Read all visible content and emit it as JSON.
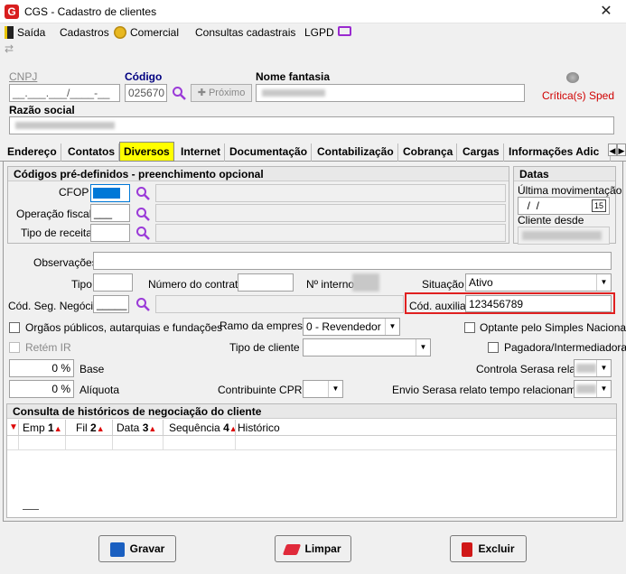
{
  "window": {
    "title": "CGS - Cadastro de clientes",
    "close": "✕"
  },
  "menu": {
    "items": [
      "Saída",
      "Cadastros",
      "Comercial",
      "Consultas cadastrais",
      "LGPD"
    ]
  },
  "header": {
    "cnpj_label": "CNPJ",
    "cnpj_value": "__.___.___/____-__",
    "codigo_label": "Código",
    "codigo_value": "025670",
    "proximo_label": "Próximo",
    "nome_fantasia_label": "Nome fantasia",
    "criticas_label": "Crítica(s) Sped",
    "razao_social_label": "Razão social"
  },
  "tabs": [
    "Endereço",
    "Contatos",
    "Diversos",
    "Internet",
    "Documentação",
    "Contabilização",
    "Cobrança",
    "Cargas",
    "Informações Adic"
  ],
  "active_tab": "Diversos",
  "codigos": {
    "title": "Códigos pré-definidos - preenchimento opcional",
    "cfop_label": "CFOP",
    "operacao_label": "Operação fiscal",
    "operacao_value": "___",
    "tipo_receita_label": "Tipo de receita"
  },
  "datas": {
    "title": "Datas",
    "ultima_label": "Última movimentação",
    "ultima_value": "  /  /",
    "cal": "15",
    "cliente_desde_label": "Cliente desde"
  },
  "form": {
    "observacoes_label": "Observações",
    "tipo_label": "Tipo",
    "numero_contrato_label": "Número do contrato",
    "n_interno_label": "Nº interno",
    "situacao_label": "Situação",
    "situacao_value": "Ativo",
    "cod_seg_label": "Cód. Seg. Negócio",
    "cod_seg_value": "_____",
    "cod_aux_label": "Cód. auxiliar",
    "cod_aux_value": "123456789",
    "orgaos_label": "Orgãos públicos, autarquias e fundações",
    "ramo_label": "Ramo da empresa",
    "ramo_value": "0 - Revendedor",
    "optante_label": "Optante pelo Simples Nacional",
    "retem_label": "Retém IR",
    "tipo_cliente_label": "Tipo de cliente",
    "pagadora_label": "Pagadora/Intermediadora",
    "base_value": "0 %",
    "base_label": "Base",
    "serasa_label": "Controla Serasa relato",
    "aliquota_value": "0 %",
    "aliquota_label": "Alíquota",
    "cprb_label": "Contribuinte CPRB",
    "envio_label": "Envio Serasa relato tempo relacionamento"
  },
  "historico": {
    "title": "Consulta de históricos de negociação do cliente",
    "columns": [
      {
        "label": "Emp",
        "order": "1"
      },
      {
        "label": "Fil",
        "order": "2"
      },
      {
        "label": "Data",
        "order": "3"
      },
      {
        "label": "Sequência",
        "order": "4"
      },
      {
        "label": "Histórico",
        "order": ""
      }
    ]
  },
  "buttons": {
    "gravar": "Gravar",
    "limpar": "Limpar",
    "excluir": "Excluir"
  },
  "colors": {
    "active_tab": "#ffff00",
    "highlight": "#e02020",
    "criticas": "#d00000",
    "code_label": "#000080"
  }
}
